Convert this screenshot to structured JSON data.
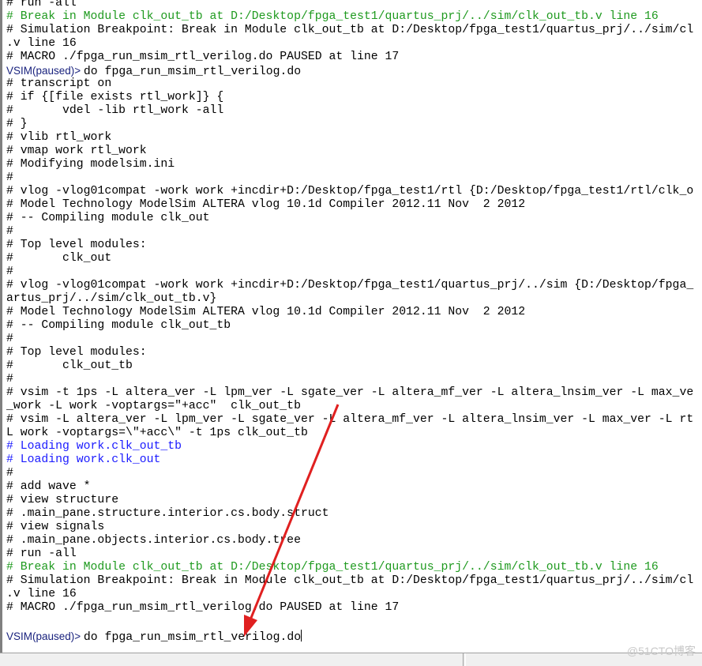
{
  "transcript": [
    {
      "text": "# run -all",
      "style": "normal"
    },
    {
      "text": "# Break in Module clk_out_tb at D:/Desktop/fpga_test1/quartus_prj/../sim/clk_out_tb.v line 16",
      "style": "green"
    },
    {
      "text": "# Simulation Breakpoint: Break in Module clk_out_tb at D:/Desktop/fpga_test1/quartus_prj/../sim/cl",
      "style": "normal"
    },
    {
      "text": ".v line 16",
      "style": "normal"
    },
    {
      "text": "# MACRO ./fpga_run_msim_rtl_verilog.do PAUSED at line 17",
      "style": "normal"
    },
    {
      "prompt": "VSIM(paused)> ",
      "text": "do fpga_run_msim_rtl_verilog.do",
      "style": "prompt"
    },
    {
      "text": "# transcript on",
      "style": "normal"
    },
    {
      "text": "# if {[file exists rtl_work]} {",
      "style": "normal"
    },
    {
      "text": "#       vdel -lib rtl_work -all",
      "style": "normal"
    },
    {
      "text": "# }",
      "style": "normal"
    },
    {
      "text": "# vlib rtl_work",
      "style": "normal"
    },
    {
      "text": "# vmap work rtl_work",
      "style": "normal"
    },
    {
      "text": "# Modifying modelsim.ini",
      "style": "normal"
    },
    {
      "text": "#",
      "style": "normal"
    },
    {
      "text": "# vlog -vlog01compat -work work +incdir+D:/Desktop/fpga_test1/rtl {D:/Desktop/fpga_test1/rtl/clk_o",
      "style": "normal"
    },
    {
      "text": "# Model Technology ModelSim ALTERA vlog 10.1d Compiler 2012.11 Nov  2 2012",
      "style": "normal"
    },
    {
      "text": "# -- Compiling module clk_out",
      "style": "normal"
    },
    {
      "text": "#",
      "style": "normal"
    },
    {
      "text": "# Top level modules:",
      "style": "normal"
    },
    {
      "text": "#       clk_out",
      "style": "normal"
    },
    {
      "text": "#",
      "style": "normal"
    },
    {
      "text": "# vlog -vlog01compat -work work +incdir+D:/Desktop/fpga_test1/quartus_prj/../sim {D:/Desktop/fpga_",
      "style": "normal"
    },
    {
      "text": "artus_prj/../sim/clk_out_tb.v}",
      "style": "normal"
    },
    {
      "text": "# Model Technology ModelSim ALTERA vlog 10.1d Compiler 2012.11 Nov  2 2012",
      "style": "normal"
    },
    {
      "text": "# -- Compiling module clk_out_tb",
      "style": "normal"
    },
    {
      "text": "#",
      "style": "normal"
    },
    {
      "text": "# Top level modules:",
      "style": "normal"
    },
    {
      "text": "#       clk_out_tb",
      "style": "normal"
    },
    {
      "text": "#",
      "style": "normal"
    },
    {
      "text": "# vsim -t 1ps -L altera_ver -L lpm_ver -L sgate_ver -L altera_mf_ver -L altera_lnsim_ver -L max_ve",
      "style": "normal"
    },
    {
      "text": "_work -L work -voptargs=\"+acc\"  clk_out_tb",
      "style": "normal"
    },
    {
      "text": "# vsim -L altera_ver -L lpm_ver -L sgate_ver -L altera_mf_ver -L altera_lnsim_ver -L max_ver -L rt",
      "style": "normal"
    },
    {
      "text": "L work -voptargs=\\\"+acc\\\" -t 1ps clk_out_tb",
      "style": "normal"
    },
    {
      "text": "# Loading work.clk_out_tb",
      "style": "blue"
    },
    {
      "text": "# Loading work.clk_out",
      "style": "blue"
    },
    {
      "text": "#",
      "style": "normal"
    },
    {
      "text": "# add wave *",
      "style": "normal"
    },
    {
      "text": "# view structure",
      "style": "normal"
    },
    {
      "text": "# .main_pane.structure.interior.cs.body.struct",
      "style": "normal"
    },
    {
      "text": "# view signals",
      "style": "normal"
    },
    {
      "text": "# .main_pane.objects.interior.cs.body.tree",
      "style": "normal"
    },
    {
      "text": "# run -all",
      "style": "normal"
    },
    {
      "text": "# Break in Module clk_out_tb at D:/Desktop/fpga_test1/quartus_prj/../sim/clk_out_tb.v line 16",
      "style": "green"
    },
    {
      "text": "# Simulation Breakpoint: Break in Module clk_out_tb at D:/Desktop/fpga_test1/quartus_prj/../sim/cl",
      "style": "normal"
    },
    {
      "text": ".v line 16",
      "style": "normal"
    },
    {
      "text": "# MACRO ./fpga_run_msim_rtl_verilog.do PAUSED at line 17",
      "style": "normal"
    }
  ],
  "command_line": {
    "prompt": "VSIM(paused)> ",
    "value": "do fpga_run_msim_rtl_verilog.do"
  },
  "watermark": "@51CTO博客",
  "colors": {
    "break": "#1f9a1f",
    "loading": "#1a1aff",
    "prompt": "#1a237e",
    "arrow": "#e02020"
  },
  "annotation": {
    "type": "arrow",
    "color": "red",
    "points_to": "command-line-input"
  }
}
